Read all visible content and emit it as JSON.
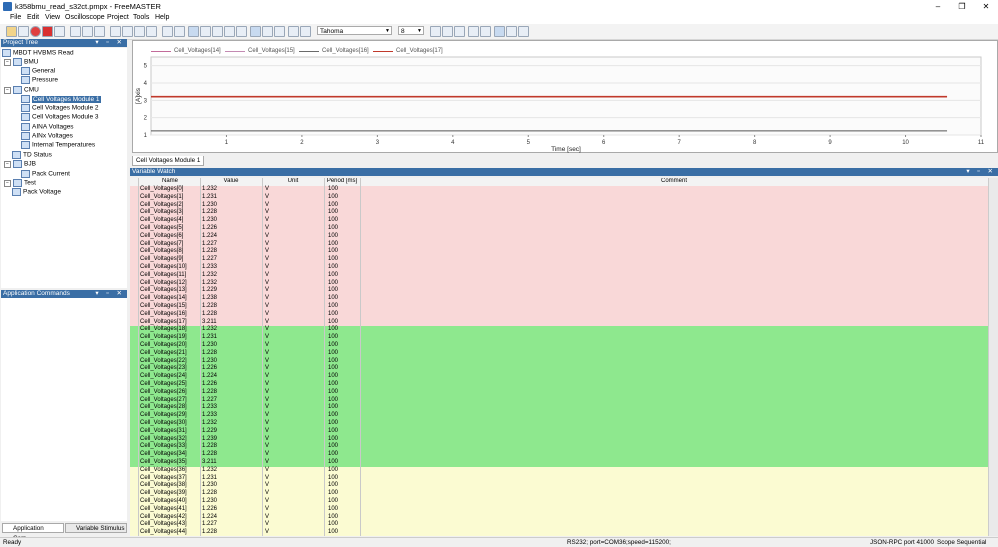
{
  "window": {
    "title": "k358bmu_read_s32ct.pmpx - FreeMASTER"
  },
  "menu": [
    "File",
    "Edit",
    "View",
    "Oscilloscope",
    "Project",
    "Tools",
    "Help"
  ],
  "toolbar": {
    "font_select": "Tahoma",
    "size_select": "8"
  },
  "project_tree": {
    "title": "Project Tree",
    "nodes": [
      {
        "label": "MBDT HVBMS Read"
      },
      {
        "label": "BMU"
      },
      {
        "label": "General"
      },
      {
        "label": "Pressure"
      },
      {
        "label": "CMU"
      },
      {
        "label": "Cell Voltages Module 1"
      },
      {
        "label": "Cell Voltages Module 2"
      },
      {
        "label": "Cell Voltages Module 3"
      },
      {
        "label": "AINA Voltages"
      },
      {
        "label": "AINx Voltages"
      },
      {
        "label": "Internal Temperatures"
      },
      {
        "label": "TD Status"
      },
      {
        "label": "BJB"
      },
      {
        "label": "Pack Current"
      },
      {
        "label": "Test"
      },
      {
        "label": "Pack Voltage"
      }
    ]
  },
  "app_commands": {
    "title": "Application Commands"
  },
  "bottom_tabs": [
    "Application Com...",
    "Variable Stimulus"
  ],
  "scope": {
    "tab": "Cell Voltages Module 1",
    "legend": [
      "Cell_Voltages[14]",
      "Cell_Voltages[15]",
      "Cell_Voltages[16]",
      "Cell_Voltages[17]"
    ],
    "legend_colors": [
      "#c26b9a",
      "#c38ab2",
      "#6a6a6a",
      "#c0392b"
    ]
  },
  "chart_data": {
    "type": "line",
    "xlabel": "Time [sec]",
    "ylabel": "[A]xis",
    "xticks": [
      "1",
      "2",
      "3",
      "4",
      "5",
      "6",
      "7",
      "8",
      "9",
      "10",
      "11"
    ],
    "yticks": [
      "1",
      "2",
      "3",
      "4",
      "5"
    ],
    "xlim": [
      0,
      11
    ],
    "ylim": [
      1,
      5.5
    ],
    "series": [
      {
        "name": "Cell_Voltages[17]",
        "x": [
          0,
          10.55
        ],
        "y": [
          3.211,
          3.211
        ]
      },
      {
        "name": "Cell_Voltages[14]",
        "x": [
          0,
          10.55
        ],
        "y": [
          1.238,
          1.238
        ]
      }
    ]
  },
  "watch": {
    "title": "Variable Watch",
    "columns": [
      "Name",
      "Value",
      "Unit",
      "Period [ms]",
      "Comment"
    ],
    "rows": [
      [
        "Cell_Voltages[0]",
        "1.232",
        "V",
        "100"
      ],
      [
        "Cell_Voltages[1]",
        "1.231",
        "V",
        "100"
      ],
      [
        "Cell_Voltages[2]",
        "1.230",
        "V",
        "100"
      ],
      [
        "Cell_Voltages[3]",
        "1.228",
        "V",
        "100"
      ],
      [
        "Cell_Voltages[4]",
        "1.230",
        "V",
        "100"
      ],
      [
        "Cell_Voltages[5]",
        "1.226",
        "V",
        "100"
      ],
      [
        "Cell_Voltages[6]",
        "1.224",
        "V",
        "100"
      ],
      [
        "Cell_Voltages[7]",
        "1.227",
        "V",
        "100"
      ],
      [
        "Cell_Voltages[8]",
        "1.228",
        "V",
        "100"
      ],
      [
        "Cell_Voltages[9]",
        "1.227",
        "V",
        "100"
      ],
      [
        "Cell_Voltages[10]",
        "1.233",
        "V",
        "100"
      ],
      [
        "Cell_Voltages[11]",
        "1.232",
        "V",
        "100"
      ],
      [
        "Cell_Voltages[12]",
        "1.232",
        "V",
        "100"
      ],
      [
        "Cell_Voltages[13]",
        "1.229",
        "V",
        "100"
      ],
      [
        "Cell_Voltages[14]",
        "1.238",
        "V",
        "100"
      ],
      [
        "Cell_Voltages[15]",
        "1.228",
        "V",
        "100"
      ],
      [
        "Cell_Voltages[16]",
        "1.228",
        "V",
        "100"
      ],
      [
        "Cell_Voltages[17]",
        "3.211",
        "V",
        "100"
      ],
      [
        "Cell_Voltages[18]",
        "1.232",
        "V",
        "100"
      ],
      [
        "Cell_Voltages[19]",
        "1.231",
        "V",
        "100"
      ],
      [
        "Cell_Voltages[20]",
        "1.230",
        "V",
        "100"
      ],
      [
        "Cell_Voltages[21]",
        "1.228",
        "V",
        "100"
      ],
      [
        "Cell_Voltages[22]",
        "1.230",
        "V",
        "100"
      ],
      [
        "Cell_Voltages[23]",
        "1.226",
        "V",
        "100"
      ],
      [
        "Cell_Voltages[24]",
        "1.224",
        "V",
        "100"
      ],
      [
        "Cell_Voltages[25]",
        "1.226",
        "V",
        "100"
      ],
      [
        "Cell_Voltages[26]",
        "1.228",
        "V",
        "100"
      ],
      [
        "Cell_Voltages[27]",
        "1.227",
        "V",
        "100"
      ],
      [
        "Cell_Voltages[28]",
        "1.233",
        "V",
        "100"
      ],
      [
        "Cell_Voltages[29]",
        "1.233",
        "V",
        "100"
      ],
      [
        "Cell_Voltages[30]",
        "1.232",
        "V",
        "100"
      ],
      [
        "Cell_Voltages[31]",
        "1.229",
        "V",
        "100"
      ],
      [
        "Cell_Voltages[32]",
        "1.239",
        "V",
        "100"
      ],
      [
        "Cell_Voltages[33]",
        "1.228",
        "V",
        "100"
      ],
      [
        "Cell_Voltages[34]",
        "1.228",
        "V",
        "100"
      ],
      [
        "Cell_Voltages[35]",
        "3.211",
        "V",
        "100"
      ],
      [
        "Cell_Voltages[36]",
        "1.232",
        "V",
        "100"
      ],
      [
        "Cell_Voltages[37]",
        "1.231",
        "V",
        "100"
      ],
      [
        "Cell_Voltages[38]",
        "1.230",
        "V",
        "100"
      ],
      [
        "Cell_Voltages[39]",
        "1.228",
        "V",
        "100"
      ],
      [
        "Cell_Voltages[40]",
        "1.230",
        "V",
        "100"
      ],
      [
        "Cell_Voltages[41]",
        "1.226",
        "V",
        "100"
      ],
      [
        "Cell_Voltages[42]",
        "1.224",
        "V",
        "100"
      ],
      [
        "Cell_Voltages[43]",
        "1.227",
        "V",
        "100"
      ],
      [
        "Cell_Voltages[44]",
        "1.228",
        "V",
        "100"
      ]
    ],
    "group_colors": [
      "#f9d8d8",
      "#8ee88e",
      "#fbfbd2"
    ]
  },
  "status": {
    "left": "Ready",
    "port": "RS232; port=COM36;speed=115200;",
    "rpc": "JSON-RPC port 41000",
    "mode": "Scope Sequential"
  }
}
